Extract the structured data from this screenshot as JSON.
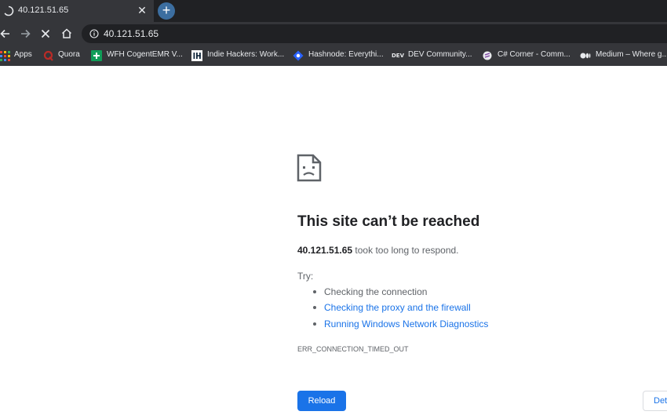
{
  "tab": {
    "title": "40.121.51.65",
    "close_glyph": "✕",
    "newtab_glyph": "+"
  },
  "toolbar": {
    "back_icon": "arrow-left-icon",
    "forward_icon": "arrow-right-icon",
    "stop_icon": "close-icon",
    "home_icon": "home-icon",
    "url": "40.121.51.65"
  },
  "bookmarks": [
    {
      "label": "Apps",
      "icon": "apps-grid-icon"
    },
    {
      "label": "Quora",
      "icon": "quora-icon"
    },
    {
      "label": "WFH CogentEMR V...",
      "icon": "sheets-icon"
    },
    {
      "label": "Indie Hackers: Work...",
      "icon": "indiehackers-icon"
    },
    {
      "label": "Hashnode: Everythi...",
      "icon": "hashnode-icon"
    },
    {
      "label": "DEV Community...",
      "icon": "dev-icon"
    },
    {
      "label": "C# Corner - Comm...",
      "icon": "csharpcorner-icon"
    },
    {
      "label": "Medium – Where g...",
      "icon": "medium-icon"
    }
  ],
  "error": {
    "title": "This site can’t be reached",
    "host": "40.121.51.65",
    "desc_suffix": "took too long to respond.",
    "try_label": "Try:",
    "suggestions": [
      {
        "text": "Checking the connection",
        "link": false
      },
      {
        "text": "Checking the proxy and the firewall",
        "link": true
      },
      {
        "text": "Running Windows Network Diagnostics",
        "link": true
      }
    ],
    "code": "ERR_CONNECTION_TIMED_OUT",
    "reload_label": "Reload",
    "details_label": "Details"
  },
  "colors": {
    "chrome_dark": "#202124",
    "chrome_toolbar": "#35363a",
    "newtab": "#3c6ea0",
    "link": "#1a73e8",
    "text_primary": "#202124",
    "text_secondary": "#5f6368"
  }
}
